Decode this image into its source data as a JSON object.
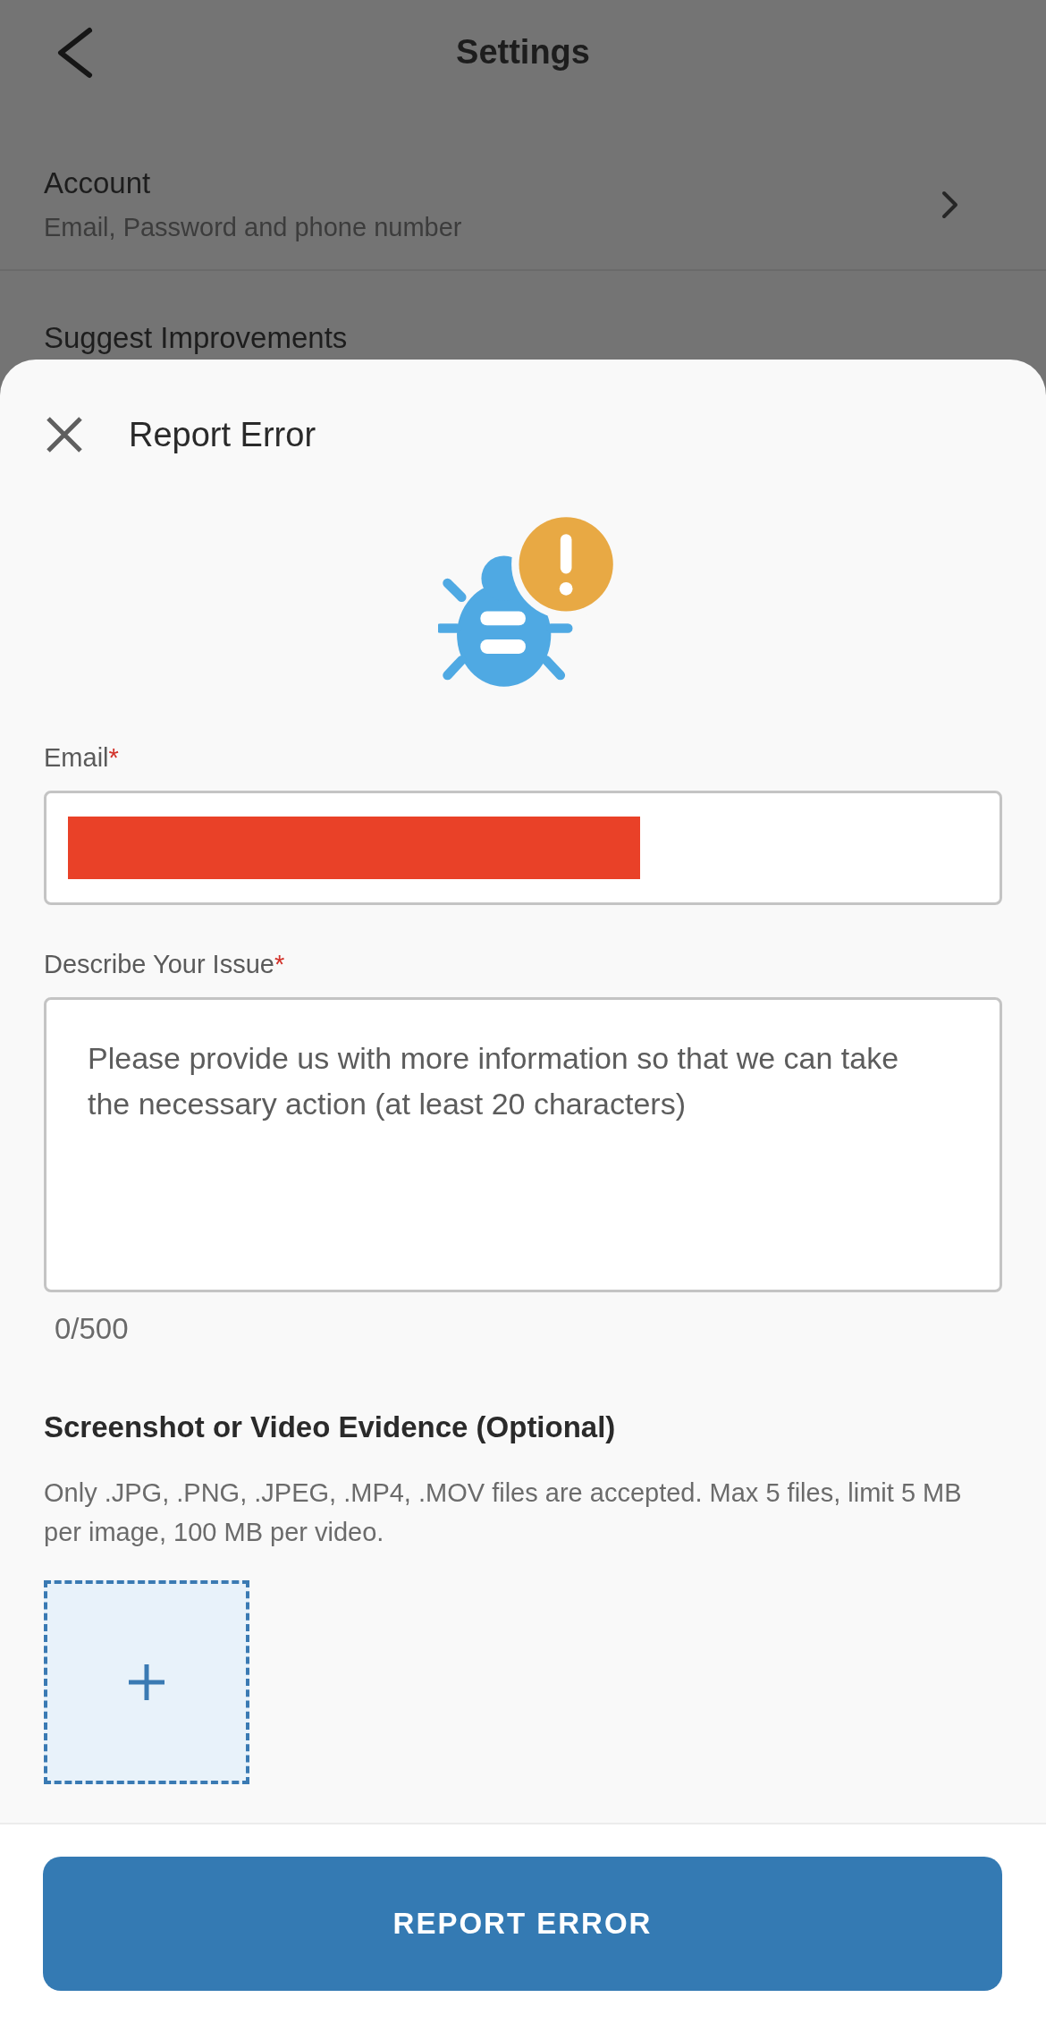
{
  "settings": {
    "title": "Settings",
    "items": [
      {
        "title": "Account",
        "subtitle": "Email, Password and phone number",
        "chevron": true
      },
      {
        "title": "Suggest Improvements"
      }
    ]
  },
  "sheet": {
    "title": "Report Error",
    "fields": [
      {
        "kind": "input",
        "label": "Email",
        "required_mark": "*",
        "redacted": true
      },
      {
        "kind": "textarea",
        "label": "Describe Your Issue",
        "required_mark": "*",
        "placeholder": "Please provide us with more information so that we can take the necessary action (at least 20 characters)",
        "counter": "0/500"
      }
    ],
    "evidence": {
      "title": "Screenshot or Video Evidence (Optional)",
      "note": "Only .JPG, .PNG, .JPEG, .MP4, .MOV files are accepted. Max 5 files, limit 5 MB per image, 100 MB per video."
    },
    "submit": "REPORT ERROR"
  }
}
